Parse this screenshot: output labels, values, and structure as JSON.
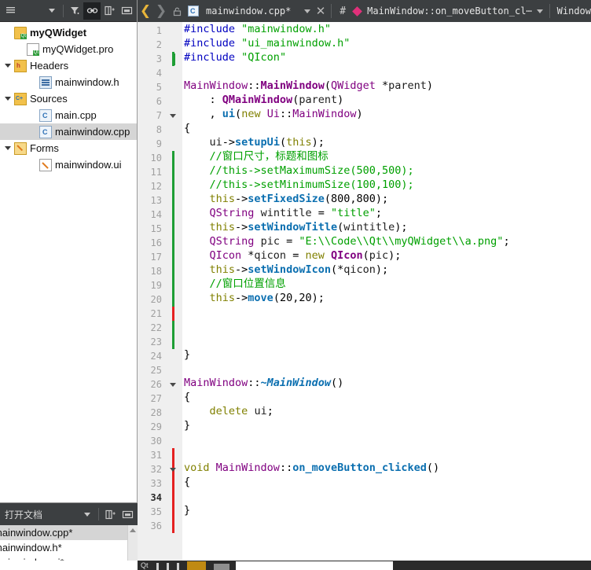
{
  "sidebar": {
    "toolbar": {
      "combo_label": "",
      "icons": [
        "list-icon",
        "chevron-down-icon",
        "filter-icon",
        "link-icon",
        "split-icon",
        "collapse-icon"
      ]
    },
    "tree": [
      {
        "label": "myQWidget",
        "indent": 0,
        "icon": "qt-project-folder-icon",
        "expander": "none",
        "bold": true,
        "selected": false
      },
      {
        "label": "myQWidget.pro",
        "indent": 1,
        "icon": "qt-pro-file-icon",
        "expander": "none",
        "bold": false,
        "selected": false
      },
      {
        "label": "Headers",
        "indent": 0,
        "icon": "headers-folder-icon",
        "expander": "down",
        "bold": false,
        "selected": false
      },
      {
        "label": "mainwindow.h",
        "indent": 2,
        "icon": "h-file-icon",
        "expander": "none",
        "bold": false,
        "selected": false
      },
      {
        "label": "Sources",
        "indent": 0,
        "icon": "sources-folder-icon",
        "expander": "down",
        "bold": false,
        "selected": false
      },
      {
        "label": "main.cpp",
        "indent": 2,
        "icon": "cpp-file-icon",
        "expander": "none",
        "bold": false,
        "selected": false
      },
      {
        "label": "mainwindow.cpp",
        "indent": 2,
        "icon": "cpp-file-icon",
        "expander": "none",
        "bold": false,
        "selected": true
      },
      {
        "label": "Forms",
        "indent": 0,
        "icon": "forms-folder-icon",
        "expander": "down",
        "bold": false,
        "selected": false
      },
      {
        "label": "mainwindow.ui",
        "indent": 2,
        "icon": "ui-file-icon",
        "expander": "none",
        "bold": false,
        "selected": false
      }
    ]
  },
  "open_documents": {
    "title": "打开文档",
    "items": [
      {
        "label": "mainwindow.cpp*",
        "selected": true
      },
      {
        "label": "mainwindow.h*",
        "selected": false
      },
      {
        "label": "mainwindow.ui*",
        "selected": false
      }
    ]
  },
  "editor_toolbar": {
    "back_icon": "chevron-left-icon",
    "forward_icon": "chevron-right-icon",
    "lock_icon": "unlocked-padlock-icon",
    "file_icon": "cpp-file-icon",
    "filename": "mainwindow.cpp*",
    "dropdown_icon": "chevron-down-icon",
    "close_icon": "close-icon",
    "hash_label": "#",
    "symbol_marker_icon": "method-diamond-icon",
    "symbol_label": "MainWindow::on_moveButton_cl⋯",
    "window_label": "Window"
  },
  "code": {
    "line_numbers": [
      1,
      2,
      3,
      4,
      5,
      6,
      7,
      8,
      9,
      10,
      11,
      12,
      13,
      14,
      15,
      16,
      17,
      18,
      19,
      20,
      21,
      22,
      23,
      24,
      25,
      26,
      27,
      28,
      29,
      30,
      31,
      32,
      33,
      34,
      35,
      36
    ],
    "current_line": 34,
    "fold_markers": [
      7,
      26,
      32
    ],
    "change_bars": [
      {
        "from_line": 3,
        "to_line": 3,
        "color": "#1e9e35"
      },
      {
        "from_line": 10,
        "to_line": 20,
        "color": "#1e9e35"
      },
      {
        "from_line": 21,
        "to_line": 21,
        "color": "#e52020"
      },
      {
        "from_line": 22,
        "to_line": 23,
        "color": "#1e9e35"
      },
      {
        "from_line": 31,
        "to_line": 36,
        "color": "#e52020"
      }
    ],
    "lines": [
      "#include \"mainwindow.h\"",
      "#include \"ui_mainwindow.h\"",
      "#include \"QIcon\"",
      "",
      "MainWindow::MainWindow(QWidget *parent)",
      "    : QMainWindow(parent)",
      "    , ui(new Ui::MainWindow)",
      "{",
      "    ui->setupUi(this);",
      "    //窗口尺寸，标题和图标",
      "    //this->setMaximumSize(500,500);",
      "    //this->setMinimumSize(100,100);",
      "    this->setFixedSize(800,800);",
      "    QString wintitle = \"title\";",
      "    this->setWindowTitle(wintitle);",
      "    QString pic = \"E:\\\\Code\\\\Qt\\\\myQWidget\\\\a.png\";",
      "    QIcon *qicon = new QIcon(pic);",
      "    this->setWindowIcon(*qicon);",
      "    //窗口位置信息",
      "    this->move(20,20);",
      "",
      "",
      "",
      "}",
      "",
      "MainWindow::~MainWindow()",
      "{",
      "    delete ui;",
      "}",
      "",
      "",
      "void MainWindow::on_moveButton_clicked()",
      "{",
      "",
      "}",
      ""
    ]
  },
  "taskbar": {
    "app_label": "Qt",
    "search_placeholder": ""
  },
  "colors": {
    "toolbar_bg": "#3c3f41",
    "gutter_bg": "#efefef",
    "selection_bg": "#d5d5d5",
    "accent_symbol": "#e0307a",
    "change_added": "#1e9e35",
    "change_modified": "#e52020",
    "string": "#00a000",
    "keyword": "#808000",
    "type": "#800080",
    "function": "#0b6fb0",
    "preprocessor": "#0000c0"
  }
}
